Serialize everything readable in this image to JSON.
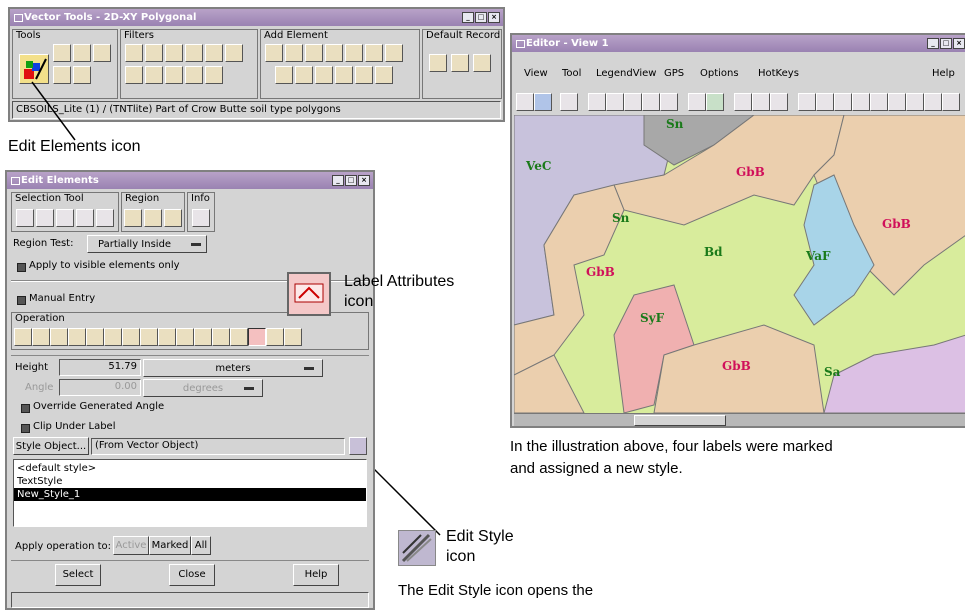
{
  "vector_tools": {
    "title": "Vector Tools - 2D-XY Polygonal",
    "groups": [
      "Tools",
      "Filters",
      "Add Element",
      "Default Record"
    ],
    "status": "CBSOILS_Lite (1) / (TNTlite) Part of Crow Butte soil type polygons"
  },
  "edit_elements": {
    "title": "Edit Elements",
    "selection_tool": "Selection Tool",
    "region": "Region",
    "info": "Info",
    "region_test_label": "Region Test:",
    "region_test_value": "Partially Inside",
    "apply_visible": "Apply to visible elements only",
    "manual_entry": "Manual Entry",
    "operation": "Operation",
    "height_label": "Height",
    "height_value": "51.79",
    "height_unit": "meters",
    "angle_label": "Angle",
    "angle_value": "0.00",
    "angle_unit": "degrees",
    "override_angle": "Override Generated Angle",
    "clip_under": "Clip Under Label",
    "style_object_label": "Style Object...",
    "style_object_value": "(From Vector Object)",
    "styles": [
      "<default style>",
      "TextStyle",
      "New_Style_1"
    ],
    "selected_style_index": 2,
    "apply_op_label": "Apply operation to:",
    "apply_active": "Active",
    "apply_marked": "Marked",
    "apply_all": "All",
    "select": "Select",
    "close": "Close",
    "help": "Help"
  },
  "editor": {
    "title": "Editor - View 1",
    "menu": [
      "View",
      "Tool",
      "LegendView",
      "GPS",
      "Options",
      "HotKeys",
      "Help"
    ],
    "map_labels": [
      "Sn",
      "VeC",
      "GbB",
      "Sn",
      "GbB",
      "Bd",
      "VaF",
      "GbB",
      "SyF",
      "GbB",
      "Sa"
    ]
  },
  "annotations": {
    "edit_elements_icon": "Edit Elements icon",
    "label_attributes_line1": "Label Attributes",
    "label_attributes_line2": "icon",
    "edit_style_line1": "Edit Style",
    "edit_style_line2": "icon",
    "caption_line1": "In the illustration above, four labels were marked",
    "caption_line2": "and assigned a new style.",
    "edit_style_text": "The Edit Style icon opens the"
  },
  "colors": {
    "title_bar": "#9a82b2",
    "window_bg": "#d4d4d4",
    "map_label": "#d0105a",
    "map_label_green": "#1a7a1a"
  }
}
